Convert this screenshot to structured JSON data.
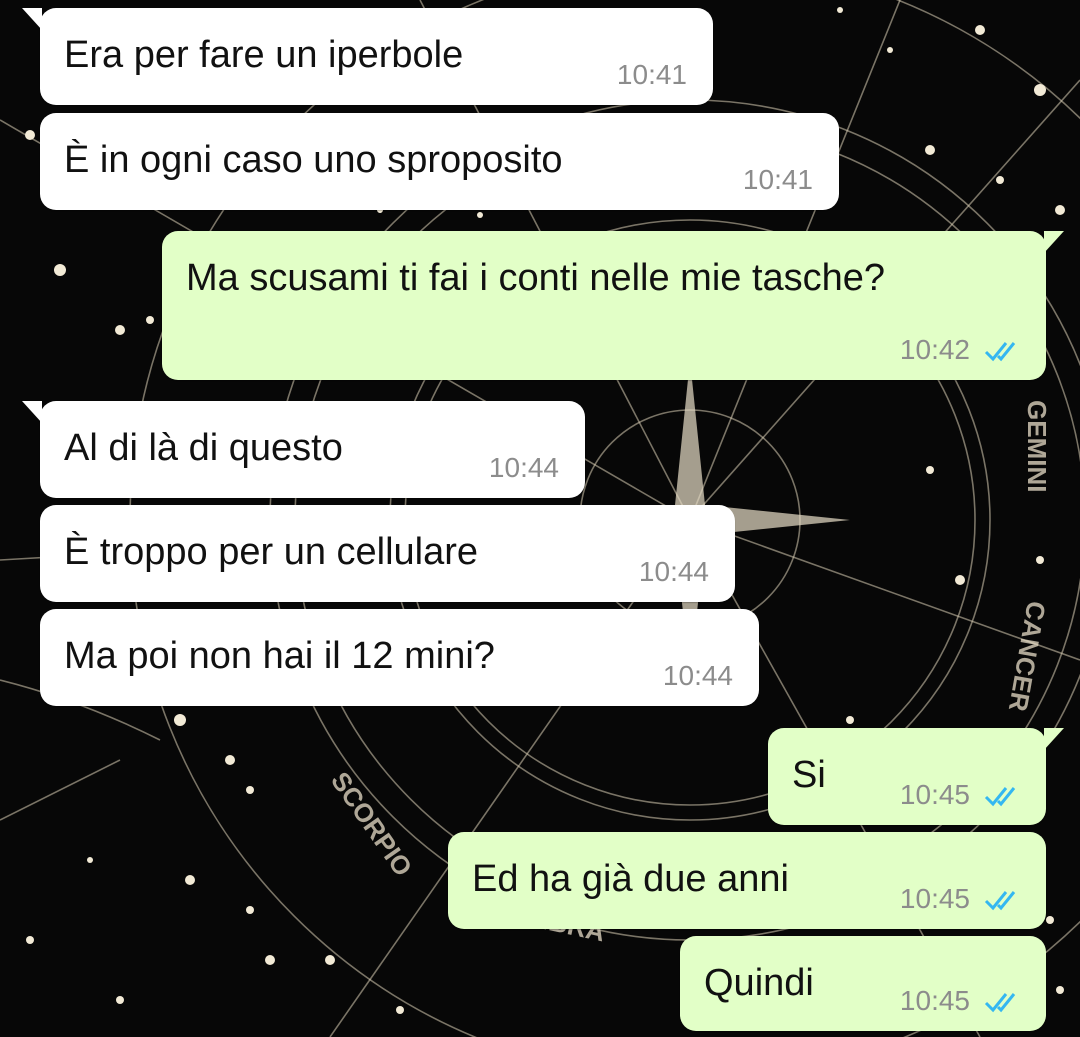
{
  "chat": {
    "messages": [
      {
        "direction": "in",
        "text": "Era per fare un iperbole",
        "time": "10:41",
        "tail": true,
        "read": false
      },
      {
        "direction": "in",
        "text": "È in ogni caso uno sproposito",
        "time": "10:41",
        "tail": false,
        "read": false
      },
      {
        "direction": "out",
        "text": "Ma scusami ti fai i conti nelle mie tasche?",
        "time": "10:42",
        "tail": true,
        "read": true
      },
      {
        "direction": "in",
        "text": "Al di là di questo",
        "time": "10:44",
        "tail": true,
        "read": false
      },
      {
        "direction": "in",
        "text": "È troppo per un cellulare",
        "time": "10:44",
        "tail": false,
        "read": false
      },
      {
        "direction": "in",
        "text": "Ma poi non hai il 12 mini?",
        "time": "10:44",
        "tail": false,
        "read": false
      },
      {
        "direction": "out",
        "text": "Si",
        "time": "10:45",
        "tail": true,
        "read": true
      },
      {
        "direction": "out",
        "text": "Ed ha già due anni",
        "time": "10:45",
        "tail": false,
        "read": true
      },
      {
        "direction": "out",
        "text": "Quindi",
        "time": "10:45",
        "tail": false,
        "read": true
      }
    ]
  },
  "wallpaper": {
    "labels": {
      "gemini": "GEMINI",
      "cancer": "CANCER",
      "scorpio": "SCORPIO",
      "libra": "LIBRA"
    }
  },
  "colors": {
    "background": "#070707",
    "incoming_bubble": "#ffffff",
    "outgoing_bubble": "#e2ffc7",
    "read_ticks": "#34b7f1",
    "timestamp": "#8c8c8c",
    "wallpaper_lines": "#d8cdb5"
  }
}
